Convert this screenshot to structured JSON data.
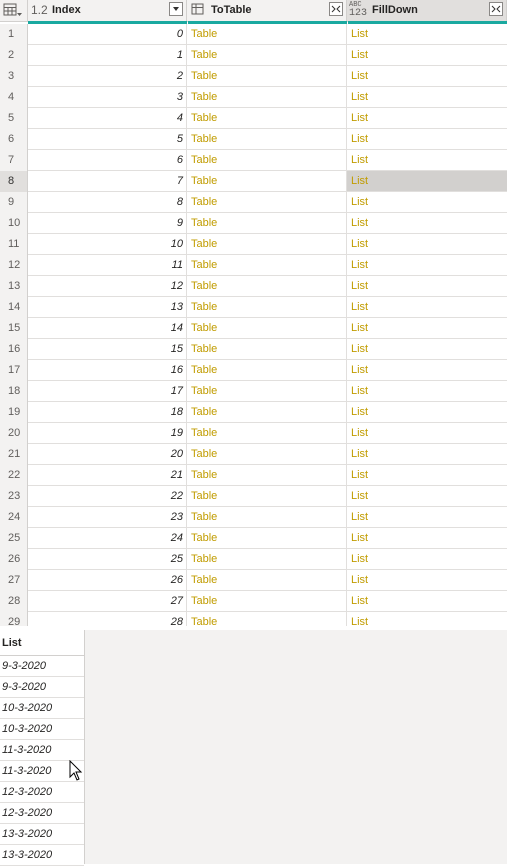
{
  "columns": {
    "index": {
      "type_label": "1.2",
      "name": "Index"
    },
    "totable": {
      "name": "ToTable"
    },
    "filldown": {
      "type_label_top": "ABC",
      "type_label_bottom": "123",
      "name": "FillDown"
    }
  },
  "rows": [
    {
      "n": "1",
      "index": "0",
      "table": "Table",
      "list": "List"
    },
    {
      "n": "2",
      "index": "1",
      "table": "Table",
      "list": "List"
    },
    {
      "n": "3",
      "index": "2",
      "table": "Table",
      "list": "List"
    },
    {
      "n": "4",
      "index": "3",
      "table": "Table",
      "list": "List"
    },
    {
      "n": "5",
      "index": "4",
      "table": "Table",
      "list": "List"
    },
    {
      "n": "6",
      "index": "5",
      "table": "Table",
      "list": "List"
    },
    {
      "n": "7",
      "index": "6",
      "table": "Table",
      "list": "List"
    },
    {
      "n": "8",
      "index": "7",
      "table": "Table",
      "list": "List"
    },
    {
      "n": "9",
      "index": "8",
      "table": "Table",
      "list": "List"
    },
    {
      "n": "10",
      "index": "9",
      "table": "Table",
      "list": "List"
    },
    {
      "n": "11",
      "index": "10",
      "table": "Table",
      "list": "List"
    },
    {
      "n": "12",
      "index": "11",
      "table": "Table",
      "list": "List"
    },
    {
      "n": "13",
      "index": "12",
      "table": "Table",
      "list": "List"
    },
    {
      "n": "14",
      "index": "13",
      "table": "Table",
      "list": "List"
    },
    {
      "n": "15",
      "index": "14",
      "table": "Table",
      "list": "List"
    },
    {
      "n": "16",
      "index": "15",
      "table": "Table",
      "list": "List"
    },
    {
      "n": "17",
      "index": "16",
      "table": "Table",
      "list": "List"
    },
    {
      "n": "18",
      "index": "17",
      "table": "Table",
      "list": "List"
    },
    {
      "n": "19",
      "index": "18",
      "table": "Table",
      "list": "List"
    },
    {
      "n": "20",
      "index": "19",
      "table": "Table",
      "list": "List"
    },
    {
      "n": "21",
      "index": "20",
      "table": "Table",
      "list": "List"
    },
    {
      "n": "22",
      "index": "21",
      "table": "Table",
      "list": "List"
    },
    {
      "n": "23",
      "index": "22",
      "table": "Table",
      "list": "List"
    },
    {
      "n": "24",
      "index": "23",
      "table": "Table",
      "list": "List"
    },
    {
      "n": "25",
      "index": "24",
      "table": "Table",
      "list": "List"
    },
    {
      "n": "26",
      "index": "25",
      "table": "Table",
      "list": "List"
    },
    {
      "n": "27",
      "index": "26",
      "table": "Table",
      "list": "List"
    },
    {
      "n": "28",
      "index": "27",
      "table": "Table",
      "list": "List"
    },
    {
      "n": "29",
      "index": "28",
      "table": "Table",
      "list": "List"
    }
  ],
  "selected_row": "8",
  "preview": {
    "header": "List",
    "items": [
      "9-3-2020",
      "9-3-2020",
      "10-3-2020",
      "10-3-2020",
      "11-3-2020",
      "11-3-2020",
      "12-3-2020",
      "12-3-2020",
      "13-3-2020",
      "13-3-2020"
    ]
  },
  "colors": {
    "quality_bar": "#1aa9a0",
    "link_text": "#c19c00",
    "selected_cell": "#d2d0ce"
  }
}
